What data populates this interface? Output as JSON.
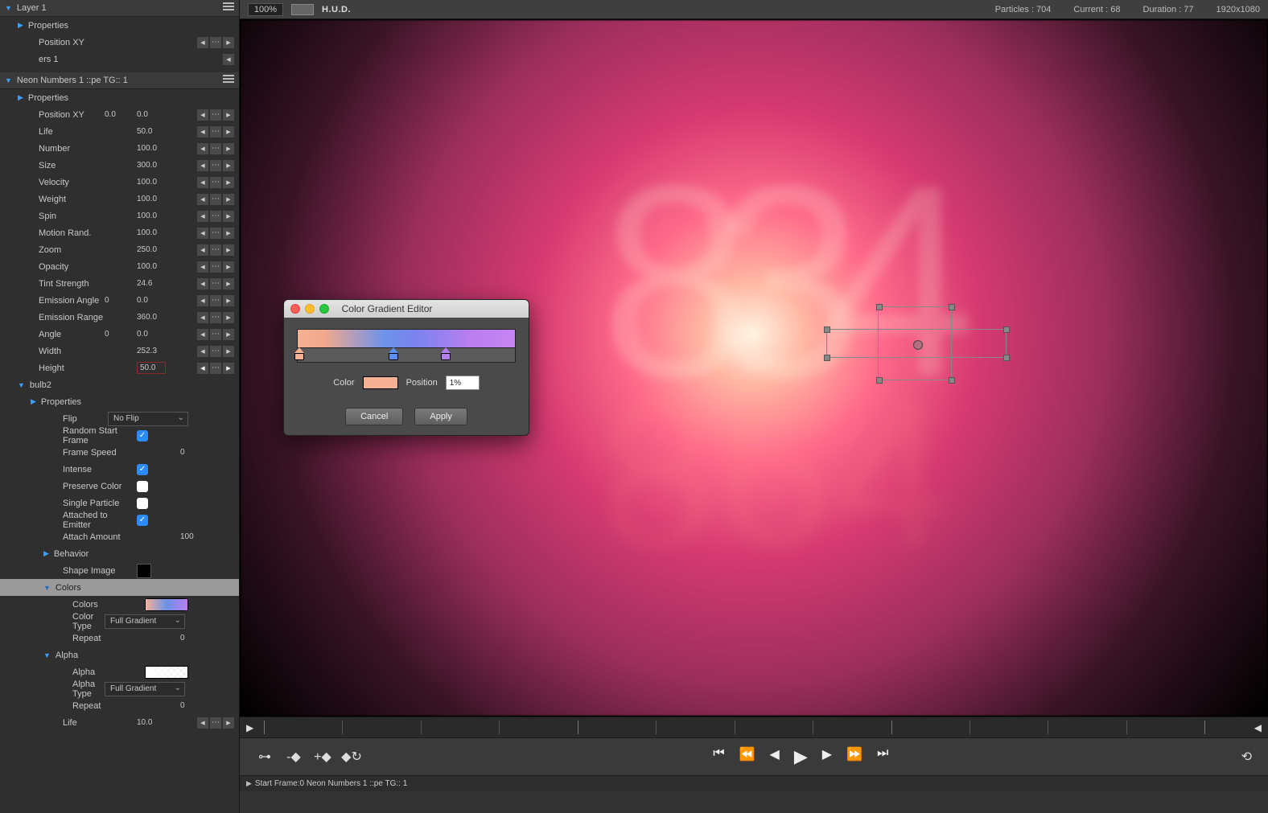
{
  "toolbar": {
    "zoom": "100%",
    "hud": "H.U.D.",
    "particles_label": "Particles :",
    "particles_value": "704",
    "current_label": "Current :",
    "current_value": "68",
    "duration_label": "Duration :",
    "duration_value": "77",
    "resolution": "1920x1080"
  },
  "tree": {
    "layer1": "Layer 1",
    "layer1_props": "Properties",
    "layer1_posxy": "Position XY",
    "layer1_ers": "ers 1",
    "neon_numbers": "Neon Numbers 1 ::pe TG:: 1",
    "neon_props": "Properties",
    "bulb2": "bulb2",
    "bulb2_props": "Properties",
    "behavior": "Behavior",
    "colors_hdr": "Colors",
    "alpha_hdr": "Alpha"
  },
  "props": {
    "posxy": {
      "label": "Position XY",
      "v1": "0.0",
      "v2": "0.0"
    },
    "life": {
      "label": "Life",
      "v": "50.0"
    },
    "number": {
      "label": "Number",
      "v": "100.0"
    },
    "size": {
      "label": "Size",
      "v": "300.0"
    },
    "velocity": {
      "label": "Velocity",
      "v": "100.0"
    },
    "weight": {
      "label": "Weight",
      "v": "100.0"
    },
    "spin": {
      "label": "Spin",
      "v": "100.0"
    },
    "motion_rand": {
      "label": "Motion Rand.",
      "v": "100.0"
    },
    "zoom": {
      "label": "Zoom",
      "v": "250.0"
    },
    "opacity": {
      "label": "Opacity",
      "v": "100.0"
    },
    "tint": {
      "label": "Tint Strength",
      "v": "24.6"
    },
    "emission_angle": {
      "label": "Emission Angle",
      "v1": "0",
      "v2": "0.0"
    },
    "emission_range": {
      "label": "Emission Range",
      "v": "360.0"
    },
    "angle": {
      "label": "Angle",
      "v1": "0",
      "v2": "0.0"
    },
    "width": {
      "label": "Width",
      "v": "252.3"
    },
    "height": {
      "label": "Height",
      "v": "50.0"
    },
    "flip": {
      "label": "Flip",
      "v": "No Flip"
    },
    "random_start": {
      "label": "Random Start Frame"
    },
    "frame_speed": {
      "label": "Frame Speed",
      "v": "0"
    },
    "intense": {
      "label": "Intense"
    },
    "preserve_color": {
      "label": "Preserve Color"
    },
    "single_particle": {
      "label": "Single Particle"
    },
    "attached": {
      "label": "Attached to Emitter"
    },
    "attach_amount": {
      "label": "Attach Amount",
      "v": "100"
    },
    "shape_image": {
      "label": "Shape Image"
    },
    "colors": {
      "label": "Colors"
    },
    "color_type": {
      "label": "Color Type",
      "v": "Full Gradient"
    },
    "repeat": {
      "label": "Repeat",
      "v": "0"
    },
    "alpha": {
      "label": "Alpha"
    },
    "alpha_type": {
      "label": "Alpha Type",
      "v": "Full Gradient"
    },
    "alpha_repeat": {
      "label": "Repeat",
      "v": "0"
    },
    "life2": {
      "label": "Life",
      "v": "10.0"
    }
  },
  "dialog": {
    "title": "Color Gradient Editor",
    "color_label": "Color",
    "position_label": "Position",
    "position_value": "1%",
    "cancel": "Cancel",
    "apply": "Apply",
    "stops": [
      {
        "pos": 1,
        "color": "#f6b094"
      },
      {
        "pos": 44,
        "color": "#5b8ff0"
      },
      {
        "pos": 68,
        "color": "#b57def"
      }
    ]
  },
  "timeline": {
    "track": "Start Frame:0 Neon Numbers 1 ::pe TG:: 1"
  }
}
